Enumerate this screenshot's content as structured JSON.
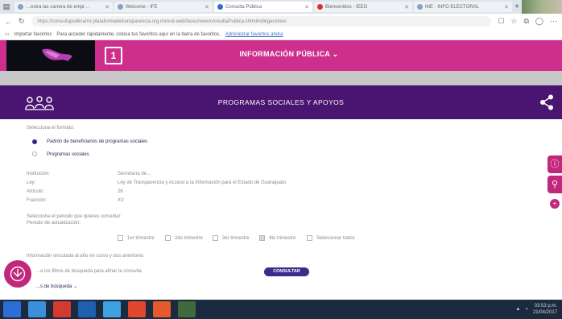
{
  "browser": {
    "tabs": [
      {
        "title": "…estra las carrera de empr…"
      },
      {
        "title": "Welcome - IFE"
      },
      {
        "title": "Consulta Pública"
      },
      {
        "title": "Bienvenidos - IEEG"
      },
      {
        "title": "INE - INFO ELECTORAL"
      }
    ],
    "url": "https://consultapublicamx.plataformadetransparencia.org.mx/vut-web/faces/view/consultaPublica.xhtml#obligaciones",
    "favorites_prompt": "Importar favoritos",
    "favorites_hint": "Para acceder rápidamente, coloca tus favoritos aquí en la barra de favoritos.",
    "favorites_link": "Administrar favoritos ahora"
  },
  "header": {
    "title": "INFORMACIÓN PÚBLICA",
    "dropdown_marker": "⌄"
  },
  "section": {
    "title": "PROGRAMAS SOCIALES Y APOYOS"
  },
  "content": {
    "select_prompt": "Selecciona el formato:",
    "options": [
      {
        "label": "Padrón de beneficiarios de programas sociales",
        "selected": true
      },
      {
        "label": "Programas sociales",
        "selected": false
      }
    ],
    "details": [
      {
        "label": "Institución:",
        "value": "Secretaría de…"
      },
      {
        "label": "Ley:",
        "value": "Ley de Transparencia y Acceso a la Información para el Estado de Guanajuato"
      },
      {
        "label": "Artículo:",
        "value": "26"
      },
      {
        "label": "Fracción:",
        "value": "XV"
      }
    ],
    "period_prompt": "Selecciona el periodo que quieres consultar:",
    "period_label": "Periodo de actualización:",
    "periods": [
      {
        "label": "1er trimestre",
        "checked": false
      },
      {
        "label": "2do trimestre",
        "checked": false
      },
      {
        "label": "3er trimestre",
        "checked": false
      },
      {
        "label": "4to trimestre",
        "checked": true
      },
      {
        "label": "Seleccionar todos",
        "checked": false
      }
    ],
    "note": "Información vinculada al año en curso y dos anteriores",
    "filter_hint": "…a los filtros de búsqueda para afinar la consulta",
    "consult_button": "CONSULTAR",
    "more_filters": "…s de búsqueda"
  },
  "taskbar": {
    "time": "03:53 p.m.",
    "date": "21/04/2017"
  },
  "colors": {
    "magenta": "#cf2f8c",
    "purple": "#4a1570",
    "button": "#3e2a8a"
  }
}
